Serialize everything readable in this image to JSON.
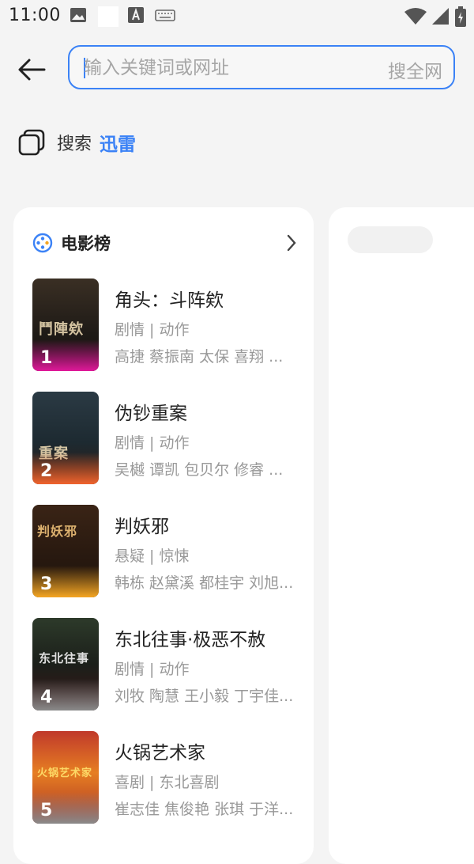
{
  "status_bar": {
    "time": "11:00"
  },
  "search": {
    "placeholder": "输入关键词或网址",
    "search_all_label": "搜全网"
  },
  "engine": {
    "label": "搜索",
    "name": "迅雷"
  },
  "ranking": {
    "title": "电影榜",
    "movies": [
      {
        "rank": "1",
        "title": "角头：斗阵欸",
        "genre": "剧情 | 动作",
        "cast": "高捷 蔡振南 太保 喜翔 ...",
        "poster_text": "鬥陣欸"
      },
      {
        "rank": "2",
        "title": "伪钞重案",
        "genre": "剧情 | 动作",
        "cast": "吴樾 谭凯 包贝尔 修睿 ...",
        "poster_text": "重案"
      },
      {
        "rank": "3",
        "title": "判妖邪",
        "genre": "悬疑 | 惊悚",
        "cast": "韩栋 赵黛溪 都桂宇 刘旭...",
        "poster_text": "判妖邪"
      },
      {
        "rank": "4",
        "title": "东北往事·极恶不赦",
        "genre": "剧情 | 动作",
        "cast": "刘牧 陶慧 王小毅 丁宇佳...",
        "poster_text": "东北往事"
      },
      {
        "rank": "5",
        "title": "火锅艺术家",
        "genre": "喜剧 | 东北喜剧",
        "cast": "崔志佳 焦俊艳 张琪 于洋...",
        "poster_text": "火锅艺术家"
      }
    ]
  },
  "colors": {
    "accent": "#3b82f6",
    "rank1": "#e0199a",
    "rank2": "#f0642e",
    "rank3": "#f5a623",
    "rank_other": "#a0a0a0"
  }
}
